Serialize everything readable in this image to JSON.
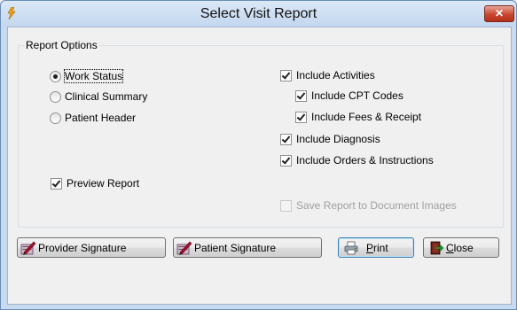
{
  "window": {
    "title": "Select Visit Report",
    "close_label": "✕"
  },
  "report_options": {
    "group_label": "Report Options",
    "report_types": [
      {
        "label": "Work Status",
        "selected": true
      },
      {
        "label": "Clinical Summary",
        "selected": false
      },
      {
        "label": "Patient Header",
        "selected": false
      }
    ],
    "preview_report": {
      "label": "Preview Report",
      "checked": true
    },
    "include_activities": {
      "label": "Include Activities",
      "checked": true
    },
    "include_cpt_codes": {
      "label": "Include CPT Codes",
      "checked": true
    },
    "include_fees_receipt": {
      "label": "Include Fees & Receipt",
      "checked": true
    },
    "include_diagnosis": {
      "label": "Include Diagnosis",
      "checked": true
    },
    "include_orders_instructions": {
      "label": "Include Orders & Instructions",
      "checked": true
    },
    "save_to_document_images": {
      "label": "Save Report to Document Images",
      "checked": false,
      "enabled": false
    }
  },
  "buttons": {
    "provider_signature": "Provider Signature",
    "patient_signature": "Patient Signature",
    "print_u": "P",
    "print_rest": "rint",
    "close_u": "C",
    "close_rest": "lose"
  },
  "icons": {
    "title": "lightning-icon",
    "signature": "signature-pen-icon",
    "print": "printer-icon",
    "close": "close-exit-icon"
  }
}
